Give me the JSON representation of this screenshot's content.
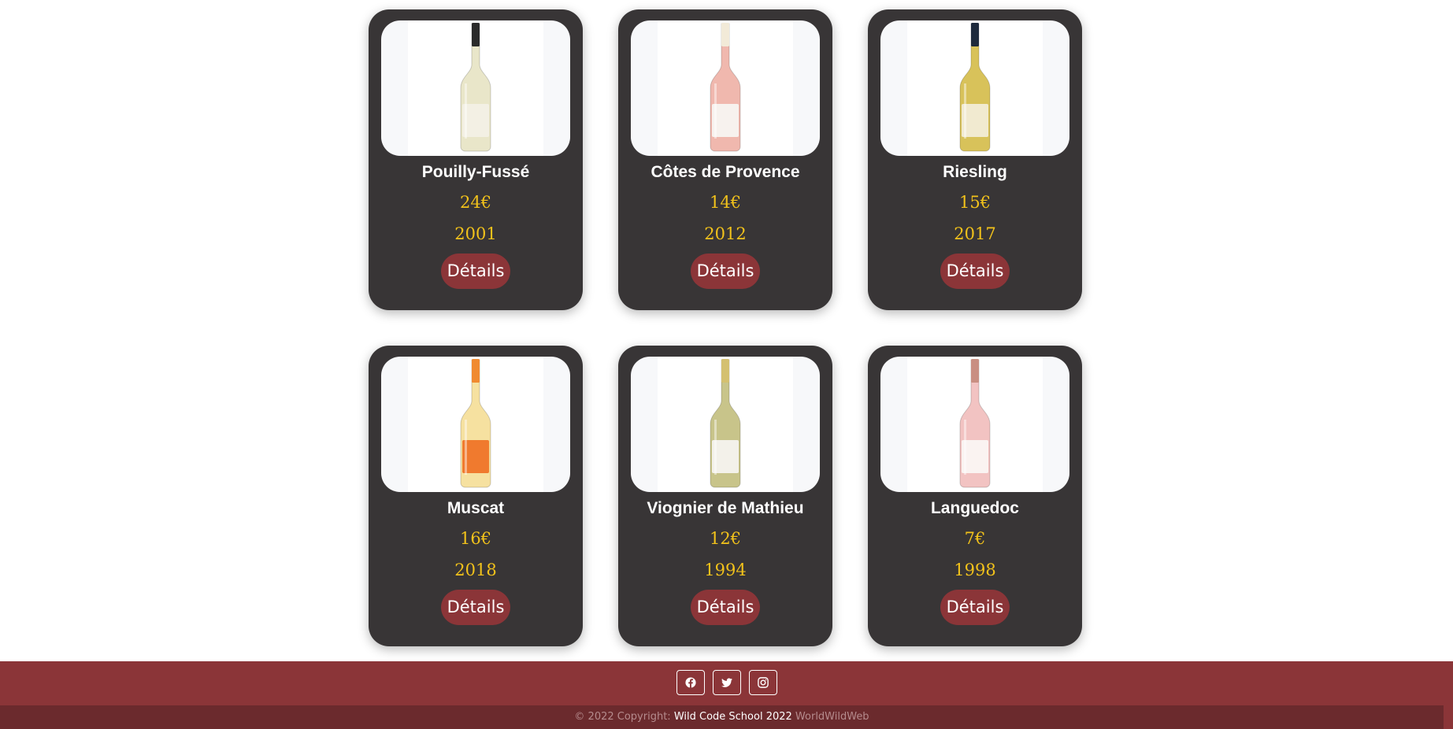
{
  "wines": [
    {
      "name": "Pouilly-Fussé",
      "price": "24€",
      "year": "2001",
      "button_label": "Détails",
      "bottle_color": "#e9e6c9",
      "label_color": "#f3f0e4",
      "cap_color": "#2b2b2b"
    },
    {
      "name": "Côtes de Provence",
      "price": "14€",
      "year": "2012",
      "button_label": "Détails",
      "bottle_color": "#f0b8ae",
      "label_color": "#f7f2ee",
      "cap_color": "#f2ead8"
    },
    {
      "name": "Riesling",
      "price": "15€",
      "year": "2017",
      "button_label": "Détails",
      "bottle_color": "#d8c25a",
      "label_color": "#f1ead0",
      "cap_color": "#1e2a3c"
    },
    {
      "name": "Muscat",
      "price": "16€",
      "year": "2018",
      "button_label": "Détails",
      "bottle_color": "#f6e1a0",
      "label_color": "#f07a2e",
      "cap_color": "#f08a30"
    },
    {
      "name": "Viognier de Mathieu",
      "price": "12€",
      "year": "1994",
      "button_label": "Détails",
      "bottle_color": "#c8c48a",
      "label_color": "#f3f1ea",
      "cap_color": "#d4c070"
    },
    {
      "name": "Languedoc",
      "price": "7€",
      "year": "1998",
      "button_label": "Détails",
      "bottle_color": "#f2c3c2",
      "label_color": "#faf3f1",
      "cap_color": "#c98f82"
    }
  ],
  "footer": {
    "socials": [
      {
        "icon": "facebook-icon"
      },
      {
        "icon": "twitter-icon"
      },
      {
        "icon": "instagram-icon"
      }
    ],
    "copyright_prefix": "© 2022 Copyright:",
    "copyright_school": "Wild Code School 2022",
    "copyright_brand": "WorldWildWeb"
  },
  "colors": {
    "card_bg": "#383536",
    "accent_red": "#8b3538",
    "price_yellow": "#f2c21b",
    "footer_dark": "#6b2a2d"
  }
}
